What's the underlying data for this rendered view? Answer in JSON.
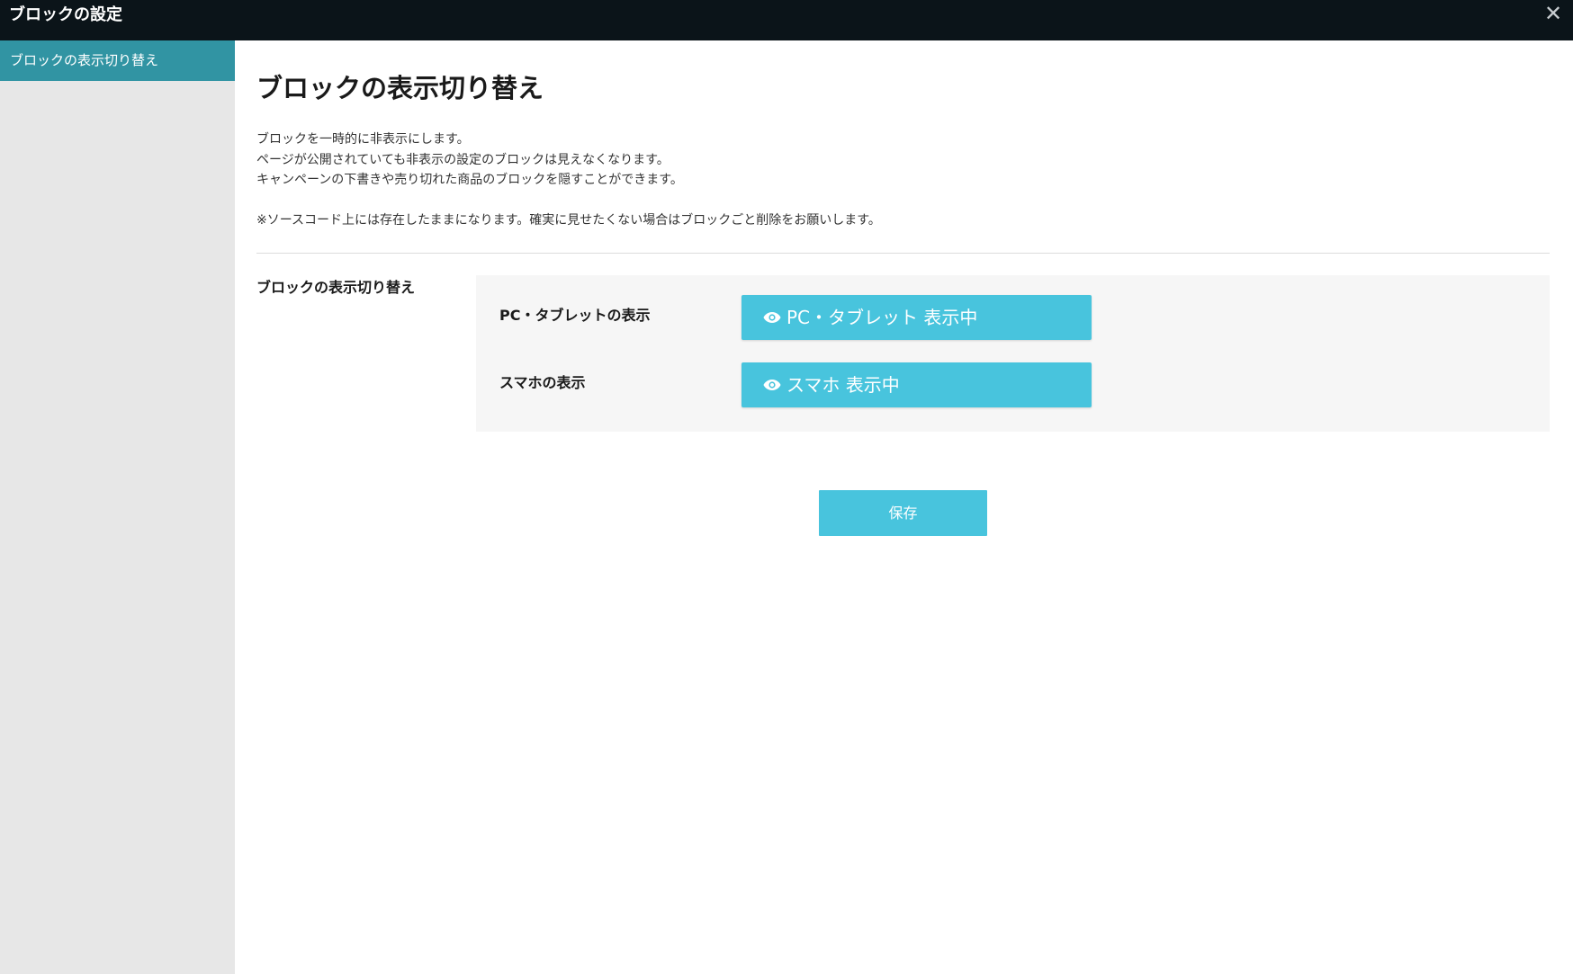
{
  "window": {
    "title": "ブロックの設定",
    "close_icon": "close-icon"
  },
  "sidebar": {
    "items": [
      {
        "label": "ブロックの表示切り替え",
        "active": true
      }
    ]
  },
  "main": {
    "title": "ブロックの表示切り替え",
    "description": [
      "ブロックを一時的に非表示にします。",
      "ページが公開されていても非表示の設定のブロックは見えなくなります。",
      "キャンペーンの下書きや売り切れた商品のブロックを隠すことができます。"
    ],
    "note": "※ソースコード上には存在したままになります。確実に見せたくない場合はブロックごと削除をお願いします。",
    "section_label": "ブロックの表示切り替え",
    "rows": [
      {
        "label": "PC・タブレットの表示",
        "button_label": "PC・タブレット 表示中",
        "icon": "eye-icon"
      },
      {
        "label": "スマホの表示",
        "button_label": "スマホ 表示中",
        "icon": "eye-icon"
      }
    ],
    "save_label": "保存"
  },
  "colors": {
    "titlebar_bg": "#0b1419",
    "sidebar_active_bg": "#3194a3",
    "sidebar_bg": "#e7e7e7",
    "accent_button": "#48c4dd",
    "panel_bg": "#f6f6f6"
  }
}
